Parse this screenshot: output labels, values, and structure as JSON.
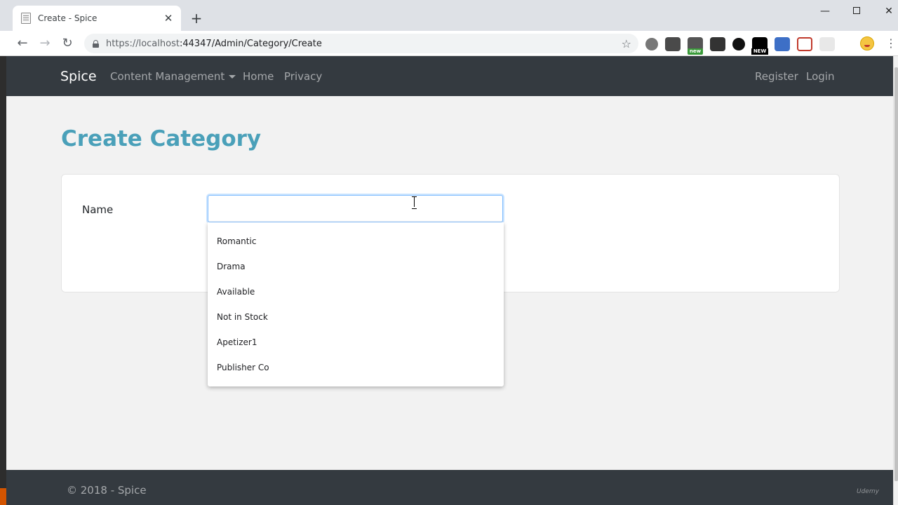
{
  "browser": {
    "tab_title": "Create - Spice",
    "tab_close": "✕",
    "new_tab": "+",
    "url_host": "https://localhost",
    "url_rest": ":44347/Admin/Category/Create",
    "window_controls": {
      "minimize": "—",
      "close": "✕"
    },
    "extensions": [
      {
        "name": "globe-extension-icon",
        "label": ""
      },
      {
        "name": "pen-extension-icon",
        "label": ""
      },
      {
        "name": "capture-extension-icon",
        "label": "new"
      },
      {
        "name": "screen-extension-icon",
        "label": ""
      },
      {
        "name": "e-extension-icon",
        "label": ""
      },
      {
        "name": "new-extension-icon",
        "label": "NEW"
      },
      {
        "name": "download-extension-icon",
        "label": ""
      },
      {
        "name": "pocket-extension-icon",
        "label": ""
      },
      {
        "name": "blank-extension-icon",
        "label": ""
      }
    ]
  },
  "navbar": {
    "brand": "Spice",
    "content_management": "Content Management",
    "home": "Home",
    "privacy": "Privacy",
    "register": "Register",
    "login": "Login"
  },
  "main": {
    "title": "Create Category",
    "name_label": "Name",
    "name_value": ""
  },
  "autocomplete": {
    "options": [
      "Romantic",
      "Drama",
      "Available",
      "Not in Stock",
      "Apetizer1",
      "Publisher Co"
    ]
  },
  "footer": {
    "text": "© 2018 - Spice",
    "watermark": "Udemy"
  },
  "colors": {
    "navbar_bg": "#343a40",
    "title_color": "#4aa0b9",
    "input_focus_border": "#80bdff"
  }
}
